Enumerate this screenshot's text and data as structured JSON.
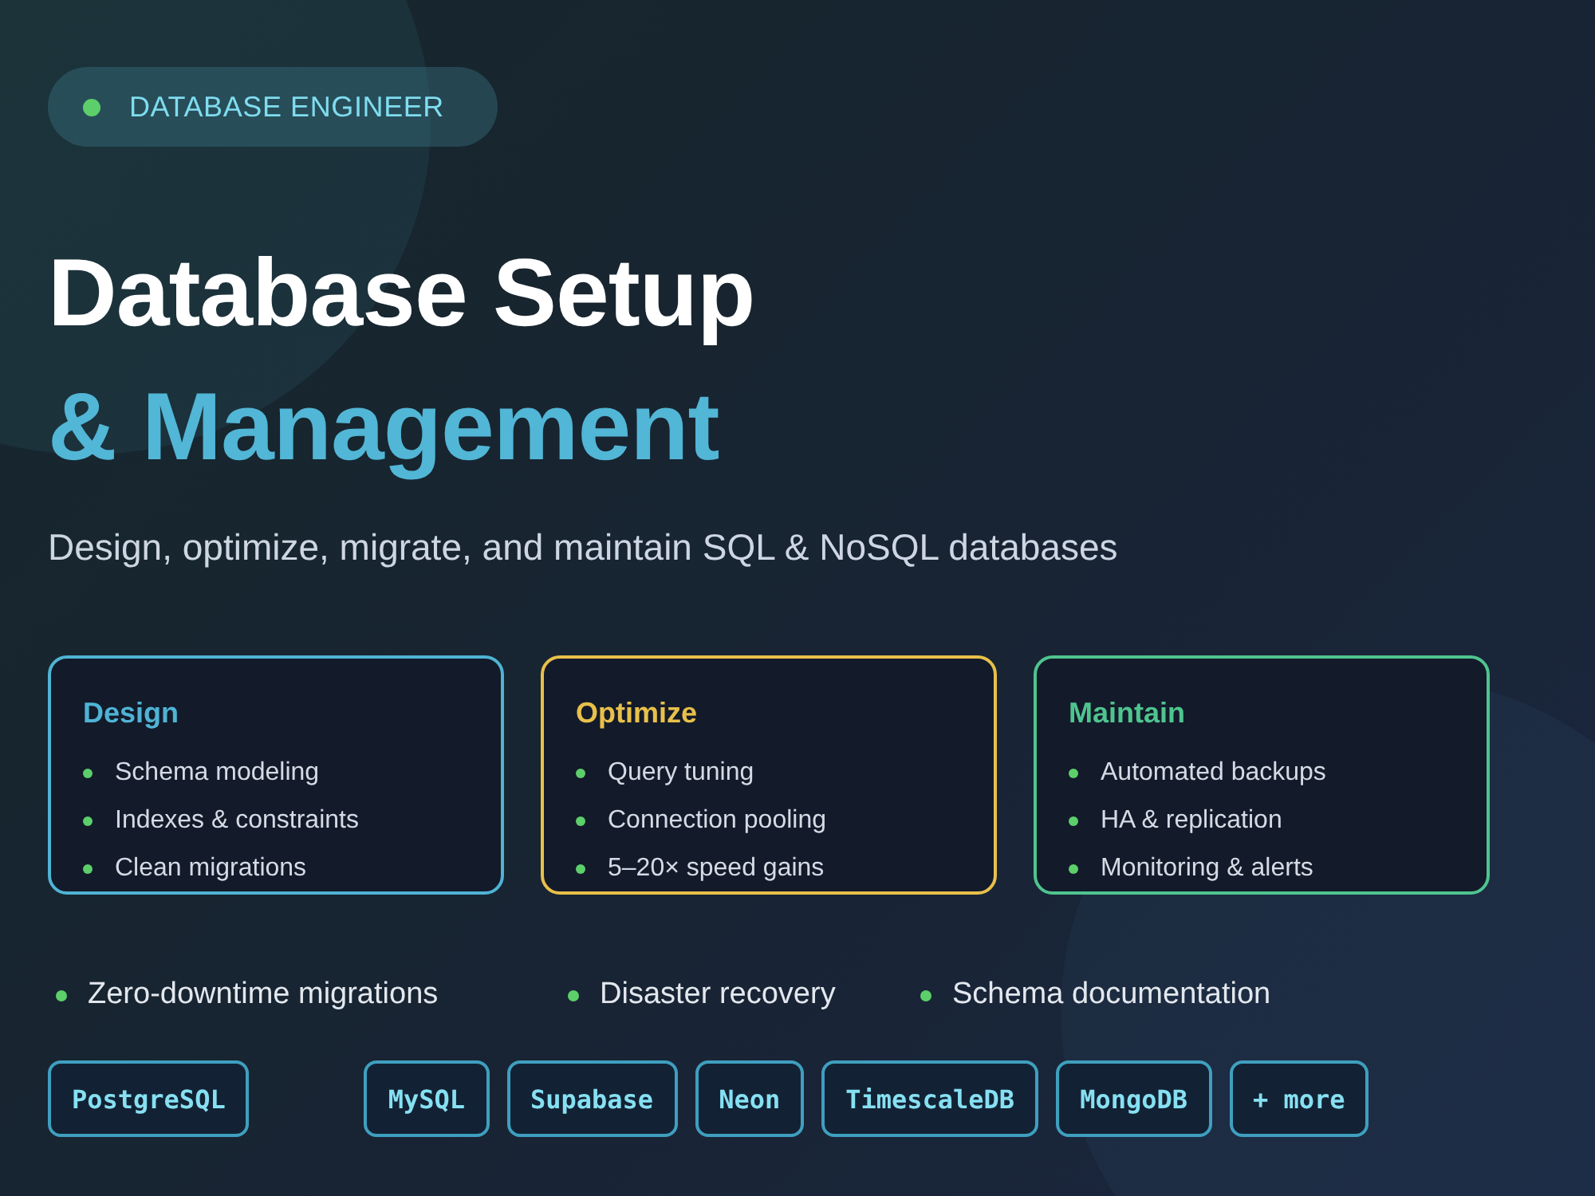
{
  "badge": {
    "label": "DATABASE ENGINEER",
    "color": "#5ccf6a"
  },
  "title": {
    "line_1": "Database Setup",
    "line_2": "& Management"
  },
  "subtitle": "Design, optimize, migrate, and maintain SQL & NoSQL databases",
  "cards": [
    {
      "title": "Design",
      "color": "#4fb3d4",
      "items": [
        "Schema modeling",
        "Indexes & constraints",
        "Clean migrations"
      ]
    },
    {
      "title": "Optimize",
      "color": "#e8c04a",
      "items": [
        "Query tuning",
        "Connection pooling",
        "5–20× speed gains"
      ]
    },
    {
      "title": "Maintain",
      "color": "#4fc48f",
      "items": [
        "Automated backups",
        "HA & replication",
        "Monitoring & alerts"
      ]
    }
  ],
  "highlights": [
    "Zero-downtime migrations",
    "Disaster recovery",
    "Schema documentation"
  ],
  "tags": [
    "PostgreSQL",
    "MySQL",
    "Supabase",
    "Neon",
    "TimescaleDB",
    "MongoDB",
    "+ more"
  ]
}
